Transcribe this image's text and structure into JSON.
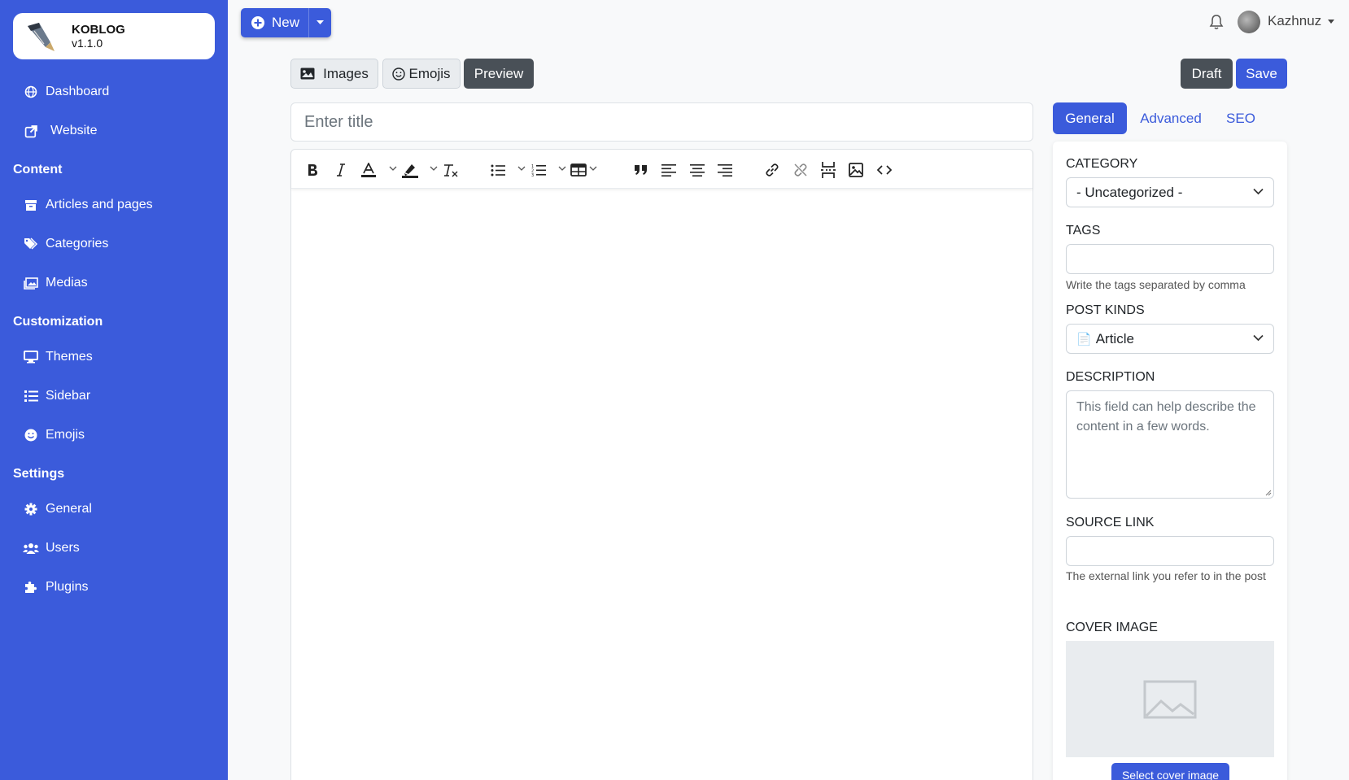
{
  "brand": {
    "name": "KOBLOG",
    "version": "v1.1.0"
  },
  "sidebar": {
    "top_items": [
      {
        "label": "Dashboard",
        "icon": "globe-icon"
      },
      {
        "label": "Website",
        "icon": "external-link-icon"
      }
    ],
    "sections": [
      {
        "title": "Content",
        "items": [
          {
            "label": "Articles and pages",
            "icon": "archive-icon"
          },
          {
            "label": "Categories",
            "icon": "tags-icon"
          },
          {
            "label": "Medias",
            "icon": "images-icon"
          }
        ]
      },
      {
        "title": "Customization",
        "items": [
          {
            "label": "Themes",
            "icon": "desktop-icon"
          },
          {
            "label": "Sidebar",
            "icon": "list-icon"
          },
          {
            "label": "Emojis",
            "icon": "smile-icon"
          }
        ]
      },
      {
        "title": "Settings",
        "items": [
          {
            "label": "General",
            "icon": "gear-icon"
          },
          {
            "label": "Users",
            "icon": "users-icon"
          },
          {
            "label": "Plugins",
            "icon": "puzzle-icon"
          }
        ]
      }
    ]
  },
  "topbar": {
    "new_label": "New",
    "username": "Kazhnuz"
  },
  "editor_actions": {
    "images": "Images",
    "emojis": "Emojis",
    "preview": "Preview",
    "draft": "Draft",
    "save": "Save"
  },
  "title_input": {
    "placeholder": "Enter title",
    "value": ""
  },
  "tabs": [
    "General",
    "Advanced",
    "SEO"
  ],
  "panel": {
    "category": {
      "label": "CATEGORY",
      "value": "- Uncategorized -"
    },
    "tags": {
      "label": "TAGS",
      "value": "",
      "help": "Write the tags separated by comma"
    },
    "post_kinds": {
      "label": "POST KINDS",
      "icon": "📄",
      "value": "Article"
    },
    "description": {
      "label": "DESCRIPTION",
      "placeholder": "This field can help describe the content in a few words."
    },
    "source_link": {
      "label": "SOURCE LINK",
      "value": "",
      "help": "The external link you refer to in the post"
    },
    "cover_image": {
      "label": "COVER IMAGE",
      "button": "Select cover image"
    }
  },
  "colors": {
    "primary": "#3b5bdb",
    "dark": "#495057",
    "background": "#f8f9fa"
  }
}
